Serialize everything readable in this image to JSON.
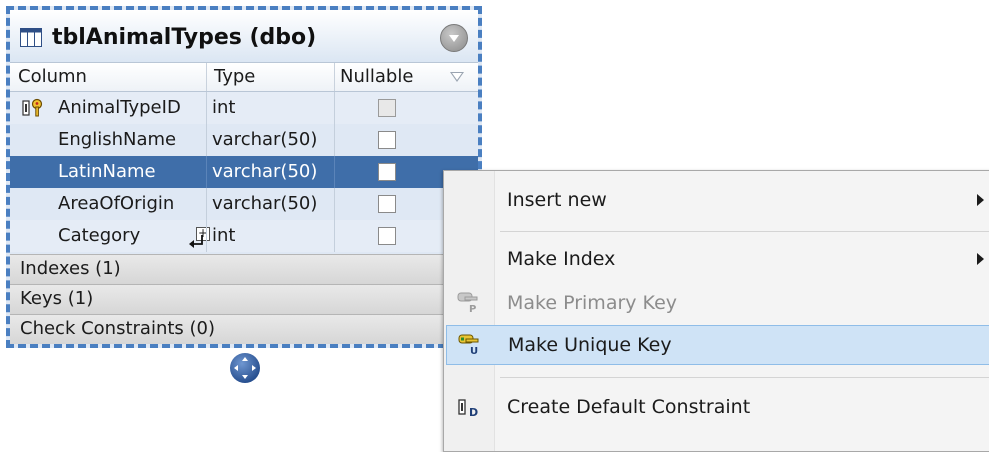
{
  "table": {
    "title": "tblAnimalTypes (dbo)",
    "columns_header": {
      "column": "Column",
      "type": "Type",
      "nullable": "Nullable"
    },
    "rows": [
      {
        "name": "AnimalTypeID",
        "type": "int",
        "nullable": false,
        "primary_key": true
      },
      {
        "name": "EnglishName",
        "type": "varchar(50)",
        "nullable": false
      },
      {
        "name": "LatinName",
        "type": "varchar(50)",
        "nullable": false,
        "selected": true
      },
      {
        "name": "AreaOfOrigin",
        "type": "varchar(50)",
        "nullable": false
      },
      {
        "name": "Category",
        "type": "int",
        "nullable": false
      }
    ],
    "sections": {
      "indexes": "Indexes (1)",
      "keys": "Keys (1)",
      "check_constraints": "Check Constraints (0)"
    }
  },
  "context_menu": {
    "items": [
      {
        "label": "Insert new",
        "submenu": true
      },
      {
        "label": "Make Index",
        "submenu": true
      },
      {
        "label": "Make Primary Key",
        "disabled": true,
        "icon": "primary-key-icon"
      },
      {
        "label": "Make Unique Key",
        "hovered": true,
        "icon": "unique-key-icon"
      },
      {
        "label": "Create Default Constraint",
        "icon": "default-constraint-icon"
      }
    ]
  },
  "colors": {
    "frame_border": "#4a7fc1",
    "selected_row": "#3f6ea9",
    "menu_hover": "#cfe3f6"
  }
}
